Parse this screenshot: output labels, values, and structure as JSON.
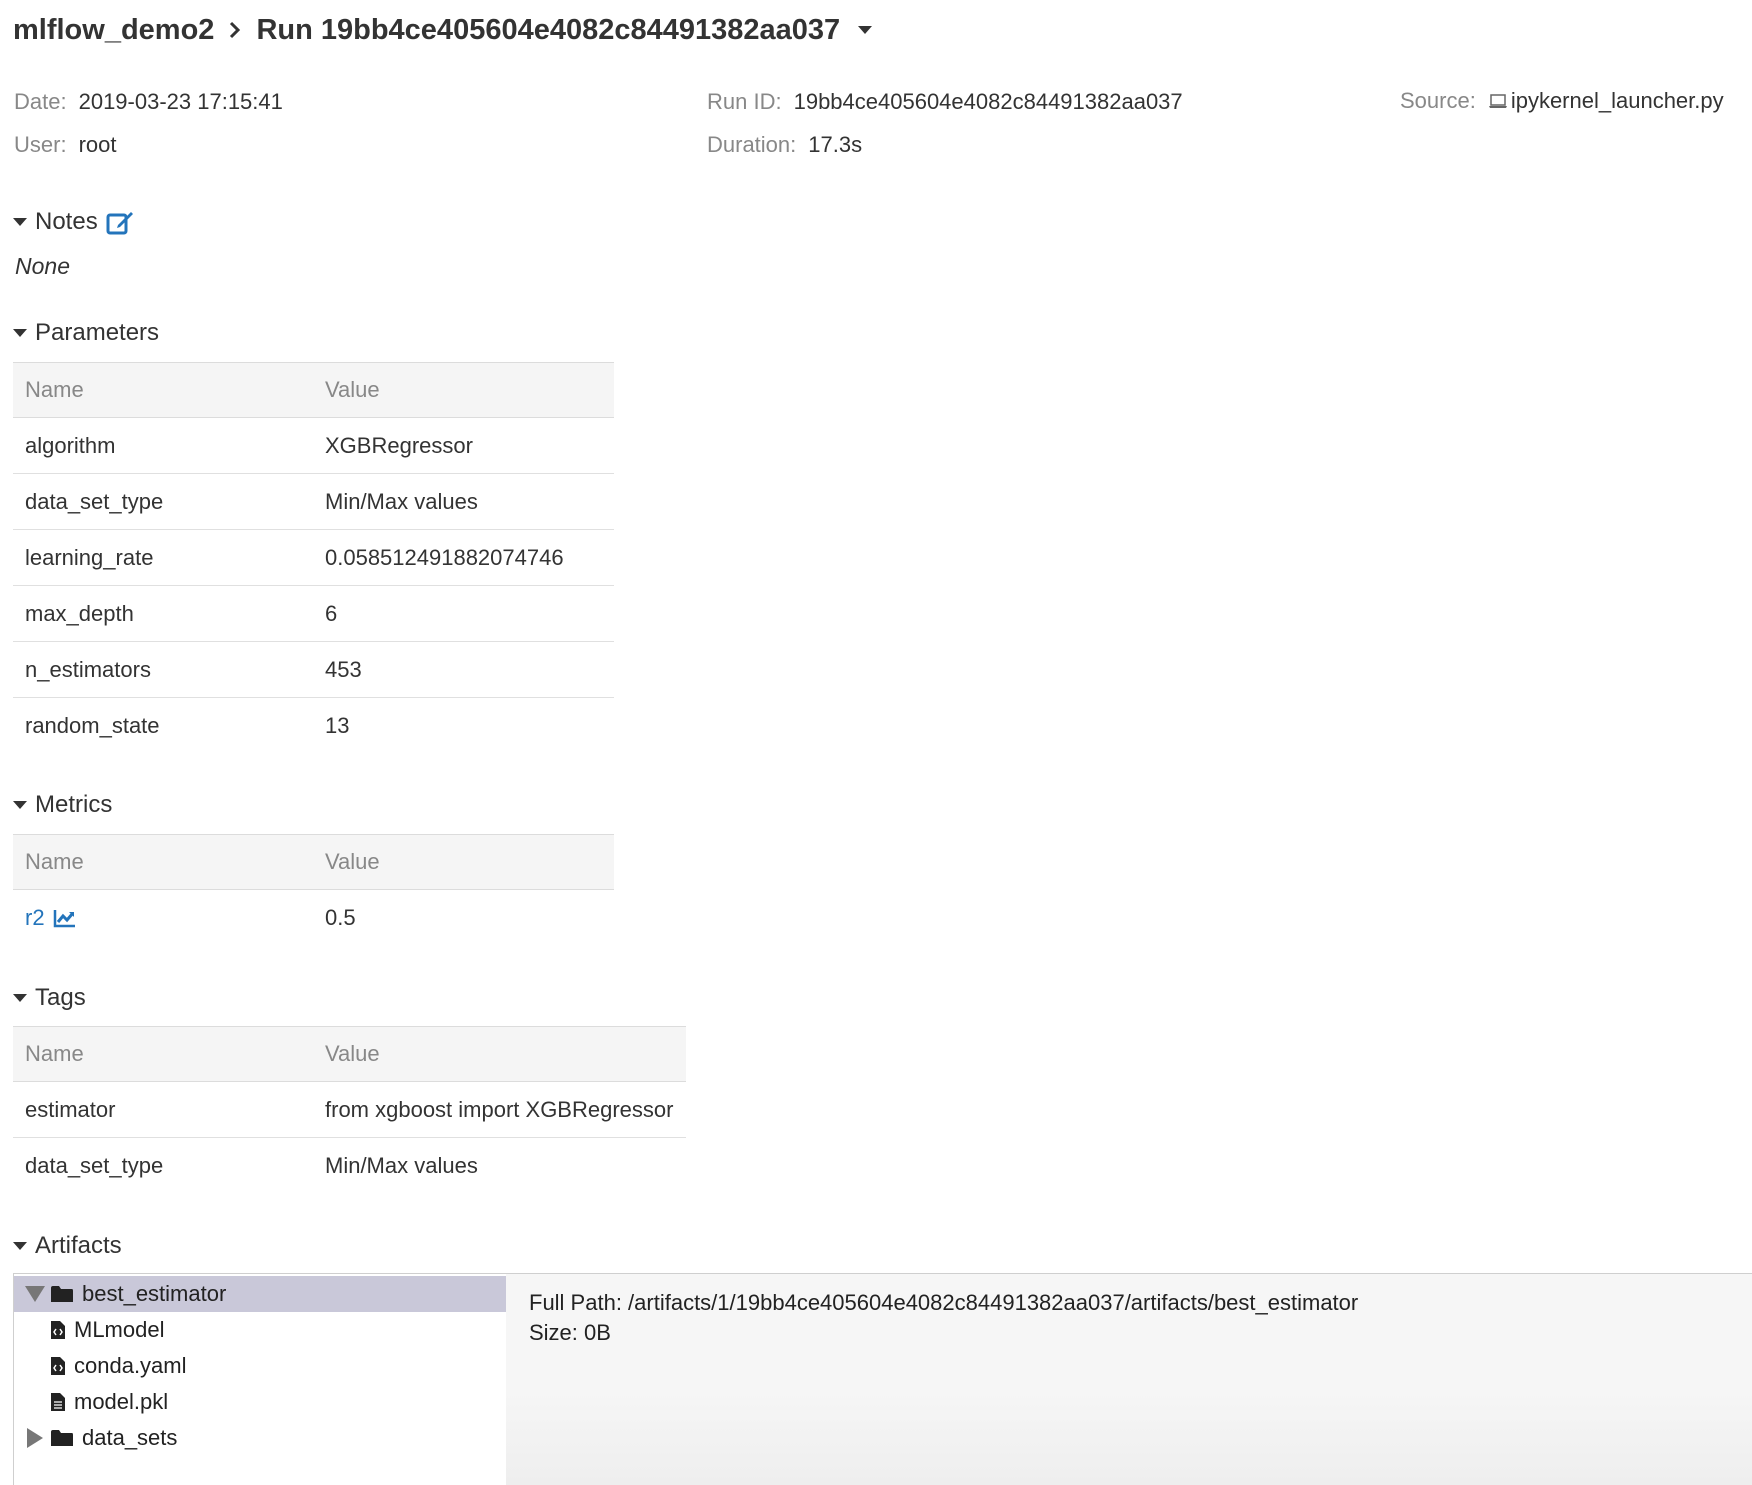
{
  "breadcrumb": {
    "experiment": "mlflow_demo2",
    "run_title": "Run 19bb4ce405604e4082c84491382aa037"
  },
  "meta": {
    "date_label": "Date:",
    "date_value": "2019-03-23 17:15:41",
    "user_label": "User:",
    "user_value": "root",
    "run_id_label": "Run ID:",
    "run_id_value": "19bb4ce405604e4082c84491382aa037",
    "duration_label": "Duration:",
    "duration_value": "17.3s",
    "source_label": "Source:",
    "source_value": "ipykernel_launcher.py",
    "source_icon": "laptop-icon"
  },
  "notes": {
    "title": "Notes",
    "content": "None",
    "edit_icon": "edit-icon"
  },
  "parameters": {
    "title": "Parameters",
    "columns": [
      "Name",
      "Value"
    ],
    "rows": [
      {
        "name": "algorithm",
        "value": "XGBRegressor"
      },
      {
        "name": "data_set_type",
        "value": "Min/Max values"
      },
      {
        "name": "learning_rate",
        "value": "0.058512491882074746"
      },
      {
        "name": "max_depth",
        "value": "6"
      },
      {
        "name": "n_estimators",
        "value": "453"
      },
      {
        "name": "random_state",
        "value": "13"
      }
    ]
  },
  "metrics": {
    "title": "Metrics",
    "columns": [
      "Name",
      "Value"
    ],
    "rows": [
      {
        "name": "r2",
        "value": "0.5",
        "icon": "line-chart-icon"
      }
    ]
  },
  "tags": {
    "title": "Tags",
    "columns": [
      "Name",
      "Value"
    ],
    "rows": [
      {
        "name": "estimator",
        "value": "from xgboost import XGBRegressor"
      },
      {
        "name": "data_set_type",
        "value": "Min/Max values"
      }
    ]
  },
  "artifacts": {
    "title": "Artifacts",
    "tree": [
      {
        "label": "best_estimator",
        "type": "folder",
        "expanded": true,
        "selected": true
      },
      {
        "label": "MLmodel",
        "type": "code-file"
      },
      {
        "label": "conda.yaml",
        "type": "code-file"
      },
      {
        "label": "model.pkl",
        "type": "file"
      },
      {
        "label": "data_sets",
        "type": "folder",
        "expanded": false,
        "selected": false
      }
    ],
    "full_path": "Full Path: /artifacts/1/19bb4ce405604e4082c84491382aa037/artifacts/best_estimator",
    "size": "Size: 0B"
  },
  "colors": {
    "link_blue": "#2374bb",
    "selected_row": "#c9c8d9",
    "header_bg": "#f5f5f5",
    "label_gray": "#888888"
  }
}
